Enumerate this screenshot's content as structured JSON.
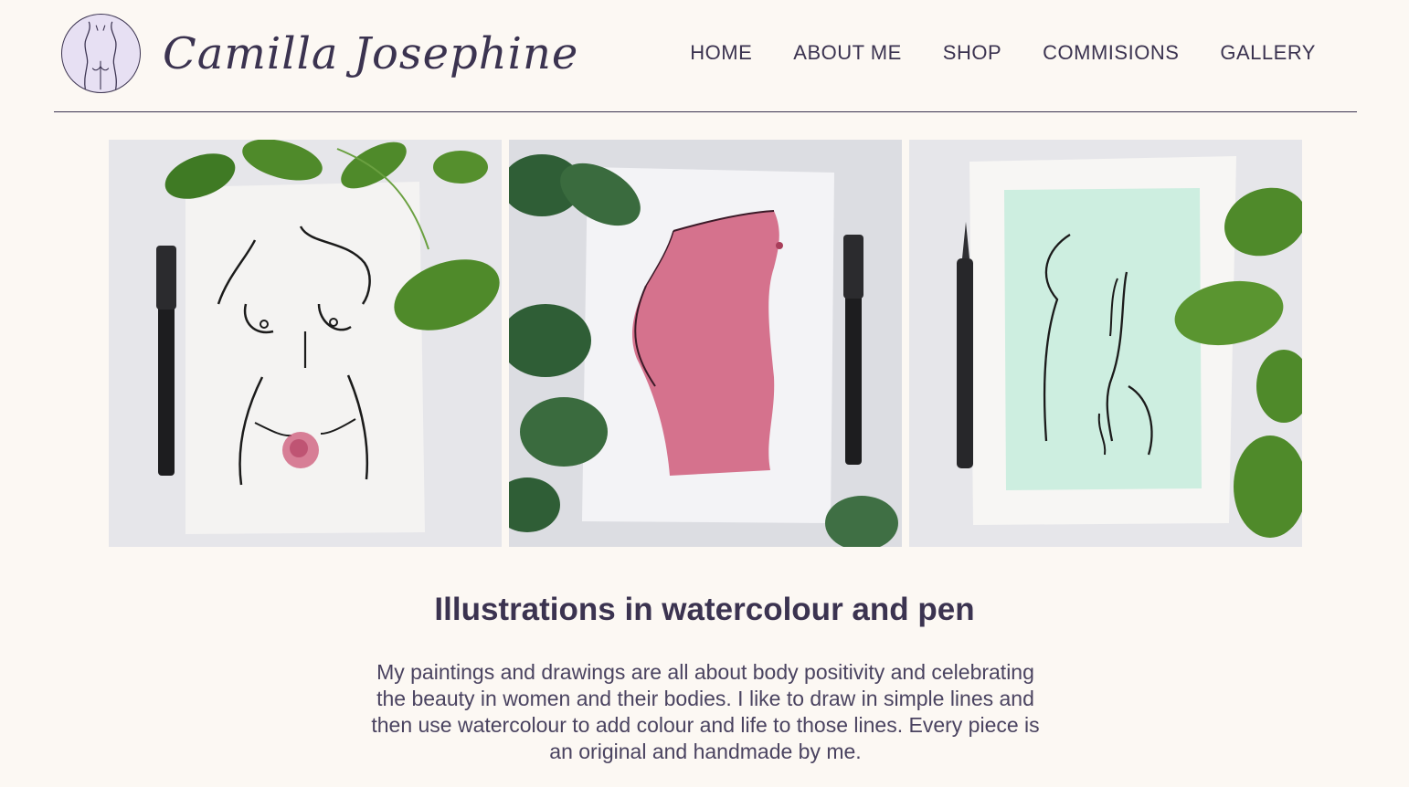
{
  "header": {
    "brand_name": "Camilla Josephine",
    "logo_icon": "torso-line-art-icon"
  },
  "nav": {
    "items": [
      {
        "label": "HOME"
      },
      {
        "label": "ABOUT ME"
      },
      {
        "label": "SHOP"
      },
      {
        "label": "COMMISIONS"
      },
      {
        "label": "GALLERY"
      }
    ]
  },
  "gallery": {
    "images": [
      {
        "subject": "front-torso-line-drawing-with-pink-rose"
      },
      {
        "subject": "pink-watercolour-torso-side-view"
      },
      {
        "subject": "back-view-line-drawing-on-mint-wash"
      }
    ]
  },
  "intro": {
    "title": "Illustrations in watercolour and pen",
    "text": "My paintings and drawings are all about body positivity and celebrating the beauty in women and their bodies. I like to draw in simple lines and then use watercolour to add colour and life to those lines. Every piece is an original and handmade by me."
  },
  "colors": {
    "background": "#fcf8f3",
    "text": "#3b3350",
    "logo_fill": "#e7e0f3",
    "leaf_green": "#4f8a2a",
    "rose_pink": "#d0607e",
    "mint_wash": "#cdeee0"
  }
}
